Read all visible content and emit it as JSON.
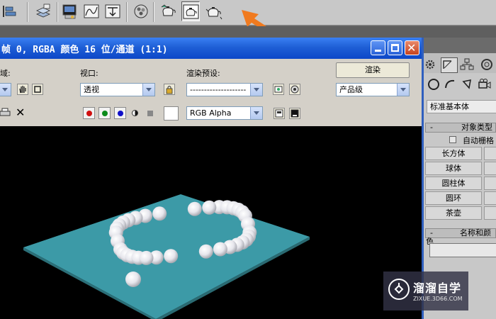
{
  "window": {
    "title": "帧 0, RGBA 颜色 16 位/通道 (1:1)"
  },
  "controls": {
    "area_label": "域:",
    "viewport_label": "视口:",
    "viewport_value": "透视",
    "preset_label": "渲染预设:",
    "preset_value": "--------------------",
    "render_button": "渲染",
    "quality_value": "产品级",
    "channel_value": "RGB Alpha"
  },
  "panel": {
    "category_value": "标准基本体",
    "object_type_label": "对象类型",
    "autogrid_label": "自动栅格",
    "buttons": [
      "长方体",
      "球体",
      "圆柱体",
      "圆环",
      "茶壶"
    ],
    "name_color_label": "名称和颜色"
  },
  "watermark": {
    "name": "溜溜自学",
    "url": "ZIXUE.3D66.COM"
  },
  "colors": {
    "titlebar": "#0c47c8",
    "plane": "#3c9aa7",
    "pearl": "#e8e8ee",
    "arrow": "#f07a1f"
  }
}
